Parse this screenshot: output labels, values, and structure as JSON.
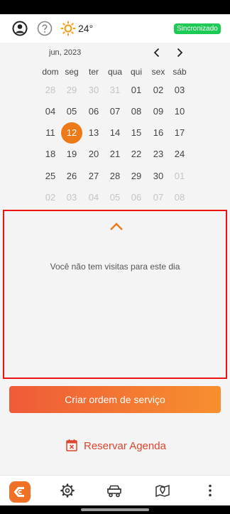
{
  "top_bar": {
    "temperature": "24°",
    "sync_status": "Sincronizado",
    "user_icon": "user-circle-icon",
    "help_icon": "help-icon",
    "weather_icon": "sun-icon",
    "sync_color": "#1ccb54"
  },
  "calendar": {
    "month_label": "jun, 2023",
    "weekdays": [
      "dom",
      "seg",
      "ter",
      "qua",
      "qui",
      "sex",
      "sáb"
    ],
    "weeks": [
      [
        "28",
        "29",
        "30",
        "31",
        "01",
        "02",
        "03"
      ],
      [
        "04",
        "05",
        "06",
        "07",
        "08",
        "09",
        "10"
      ],
      [
        "11",
        "12",
        "13",
        "14",
        "15",
        "16",
        "17"
      ],
      [
        "18",
        "19",
        "20",
        "21",
        "22",
        "23",
        "24"
      ],
      [
        "25",
        "26",
        "27",
        "28",
        "29",
        "30",
        "01"
      ],
      [
        "02",
        "03",
        "04",
        "05",
        "06",
        "07",
        "08"
      ]
    ],
    "selected_day": "12",
    "accent_color": "#ee7a17"
  },
  "visits": {
    "empty_message": "Você não tem visitas para este dia"
  },
  "actions": {
    "create_order_label": "Criar ordem de serviço",
    "reserve_agenda_label": "Reservar Agenda"
  },
  "bottom_nav": {
    "items": [
      "app-logo-icon",
      "settings-icon",
      "vehicle-icon",
      "map-pin-icon",
      "more-vertical-icon"
    ]
  }
}
